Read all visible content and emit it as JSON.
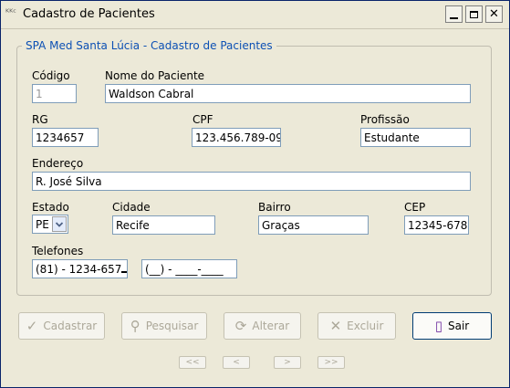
{
  "window": {
    "title": "Cadastro de Pacientes",
    "app_icon": "ᴷᴷᶜ"
  },
  "group": {
    "title": "SPA Med Santa Lúcia - Cadastro de Pacientes"
  },
  "fields": {
    "codigo": {
      "label": "Código",
      "value": "1"
    },
    "nome": {
      "label": "Nome do Paciente",
      "value": "Waldson Cabral"
    },
    "rg": {
      "label": "RG",
      "value": "1234657"
    },
    "cpf": {
      "label": "CPF",
      "value": "123.456.789-09"
    },
    "profissao": {
      "label": "Profissão",
      "value": "Estudante"
    },
    "endereco": {
      "label": "Endereço",
      "value": "R. José Silva"
    },
    "estado": {
      "label": "Estado",
      "value": "PE"
    },
    "cidade": {
      "label": "Cidade",
      "value": "Recife"
    },
    "bairro": {
      "label": "Bairro",
      "value": "Graças"
    },
    "cep": {
      "label": "CEP",
      "value": "12345-678"
    },
    "telefones": {
      "label": "Telefones",
      "value1": "(81) - 1234-657",
      "value2": "(__) - ____-____"
    }
  },
  "buttons": {
    "cadastrar": "Cadastrar",
    "pesquisar": "Pesquisar",
    "alterar": "Alterar",
    "excluir": "Excluir",
    "sair": "Sair"
  },
  "nav": {
    "first": "<<",
    "prev": "<",
    "next": ">",
    "last": ">>"
  }
}
